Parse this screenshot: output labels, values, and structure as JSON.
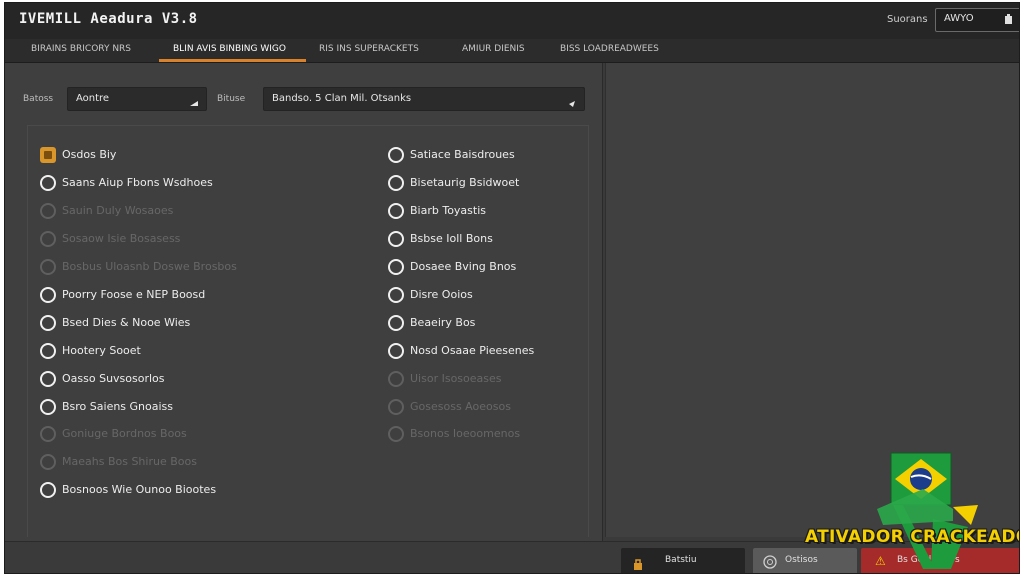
{
  "window": {
    "title": "IVEMILL Aeadura V3.8",
    "search_label": "Suorans",
    "search_value": "AWYO",
    "search_icon": "search-icon"
  },
  "tabs": [
    {
      "label": "BIRAINS BRICORY NRS",
      "active": false
    },
    {
      "label": "BLIN AVIS BINBING WIGO",
      "active": true
    },
    {
      "label": "RIS INS SUPERACKETS",
      "active": false
    },
    {
      "label": "AMIUR DIENIS",
      "active": false
    },
    {
      "label": "BISS LOADREADWEES",
      "active": false
    }
  ],
  "filters": {
    "left_label": "Batoss",
    "left_value": "Aontre",
    "right_label": "Bituse",
    "right_value": "Bandso. 5 Clan Mil. Otsanks"
  },
  "options_left": [
    {
      "label": "Osdos Biy",
      "state": "checked"
    },
    {
      "label": "Saans Aiup Fbons Wsdhoes",
      "state": "enabled"
    },
    {
      "label": "Sauin Duly Wosaoes",
      "state": "disabled"
    },
    {
      "label": "Sosaow Isie Bosasess",
      "state": "disabled"
    },
    {
      "label": "Bosbus Uloasnb Doswe Brosbos",
      "state": "disabled"
    },
    {
      "label": "Poorry Foose e NEP Boosd",
      "state": "enabled"
    },
    {
      "label": "Bsed Dies & Nooe Wies",
      "state": "enabled"
    },
    {
      "label": "Hootery Sooet",
      "state": "enabled"
    },
    {
      "label": "Oasso Suvsosorlos",
      "state": "enabled"
    },
    {
      "label": "Bsro Saiens Gnoaiss",
      "state": "enabled"
    },
    {
      "label": "Goniuge Bordnos Boos",
      "state": "disabled"
    },
    {
      "label": "Maeahs Bos Shirue Boos",
      "state": "disabled"
    },
    {
      "label": "Bosnoos Wie Ounoo Biootes",
      "state": "enabled"
    }
  ],
  "options_right": [
    {
      "label": "Satiace Baisdroues",
      "state": "enabled"
    },
    {
      "label": "Bisetaurig Bsidwoet",
      "state": "enabled"
    },
    {
      "label": "Biarb Toyastis",
      "state": "enabled"
    },
    {
      "label": "Bsbse Ioll Bons",
      "state": "enabled"
    },
    {
      "label": "Dosaee Bving Bnos",
      "state": "enabled"
    },
    {
      "label": "Disre Ooios",
      "state": "enabled"
    },
    {
      "label": "Beaeiry Bos",
      "state": "enabled"
    },
    {
      "label": "Nosd Osaae Pieesenes",
      "state": "enabled"
    },
    {
      "label": "Uisor Isosoeases",
      "state": "disabled"
    },
    {
      "label": "Gosesoss Aoeosos",
      "state": "disabled"
    },
    {
      "label": "Bsonos Ioeoomenos",
      "state": "disabled"
    }
  ],
  "bottom": {
    "button1_label": "Batstiu",
    "button2_label": "Ostisos",
    "button3_label": "Bs Geolesalos"
  },
  "watermark": {
    "text": "ATIVADOR CRACKEADO"
  },
  "colors": {
    "accent": "#d9822b",
    "checkbox": "#d9972b",
    "watermark_text": "#f5d000",
    "flag_green": "#1e9b3c",
    "flag_yellow": "#f5d000",
    "flag_blue": "#1c3c8c",
    "bottom_red": "#a52a2a"
  }
}
